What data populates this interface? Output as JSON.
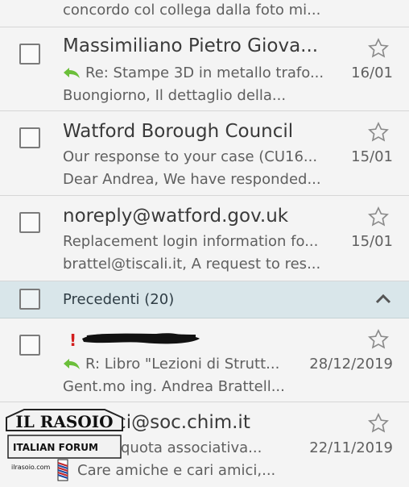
{
  "section": {
    "label": "Precedenti (20)"
  },
  "top_partial": {
    "preview": "concordo col collega dalla foto mi..."
  },
  "emails": [
    {
      "sender": "Massimiliano Pietro Giova...",
      "subject": "Re: Stampe 3D in metallo trafo...",
      "preview": "Buongiorno, Il dettaglio della...",
      "date": "16/01",
      "replied": true
    },
    {
      "sender": "Watford Borough Council",
      "subject": "Our response to your case (CU16...",
      "preview": "Dear Andrea, We have responded...",
      "date": "15/01",
      "replied": false
    },
    {
      "sender": "noreply@watford.gov.uk",
      "subject": "Replacement login information fo...",
      "preview": "brattel@tiscali.it, A request to res...",
      "date": "15/01",
      "replied": false
    }
  ],
  "older_emails": [
    {
      "sender": "",
      "important_mark": "!",
      "subject": "R: Libro \"Lezioni di Strutt...",
      "preview": "Gent.mo ing. Andrea Brattell...",
      "date": "28/12/2019",
      "replied": true
    },
    {
      "sender": "soci@soc.chim.it",
      "subject": "quota associativa...",
      "preview": "Care amiche e cari amici,...",
      "date": "22/11/2019",
      "replied": false
    }
  ],
  "watermark": {
    "line1": "IL RASOIO",
    "line2": "ITALIAN FORUM",
    "url": "ilrasoio.com"
  },
  "colors": {
    "reply_arrow": "#6bbf3a",
    "section_bg": "#d9e6ea",
    "important": "#d21e1e"
  }
}
